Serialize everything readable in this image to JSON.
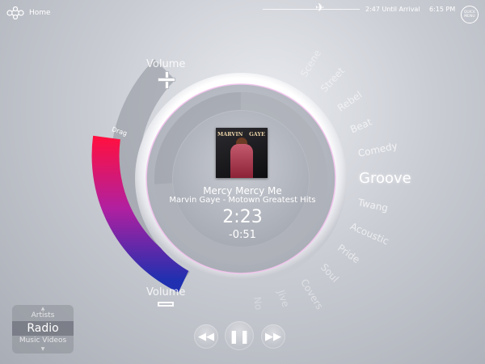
{
  "header": {
    "home_label": "Home",
    "arrival_text": "2:47 Until Arrival",
    "time": "6:15 PM",
    "quick_menu_label": "QUICK MENU"
  },
  "volume": {
    "up_label": "Volume",
    "down_label": "Volume",
    "drag_label": "Drag"
  },
  "genres": {
    "above": [
      "Scene",
      "Street",
      "Rebel",
      "Beat",
      "Comedy"
    ],
    "active": "Groove",
    "below": [
      "Twang",
      "Acoustic",
      "Pride",
      "Soul",
      "Covers",
      "Jive",
      "No"
    ]
  },
  "album": {
    "title_left": "MARVIN",
    "title_right": "GAYE"
  },
  "now_playing": {
    "song": "Mercy Mercy Me",
    "artist_album": "Marvin Gaye - Motown Greatest Hits",
    "elapsed": "2:23",
    "remaining": "-0:51",
    "progress": 0.74
  },
  "playback": {
    "rewind_icon": "rewind-icon",
    "pause_icon": "pause-icon",
    "forward_icon": "fast-forward-icon"
  },
  "source_selector": {
    "items": [
      "Artists",
      "Radio",
      "Music Videos"
    ],
    "selected": "Radio"
  },
  "colors": {
    "volume_gradient_start": "#ff1040",
    "volume_gradient_mid": "#b020a0",
    "volume_gradient_end": "#2030b0",
    "ring_glow": "#f3b8e8"
  }
}
